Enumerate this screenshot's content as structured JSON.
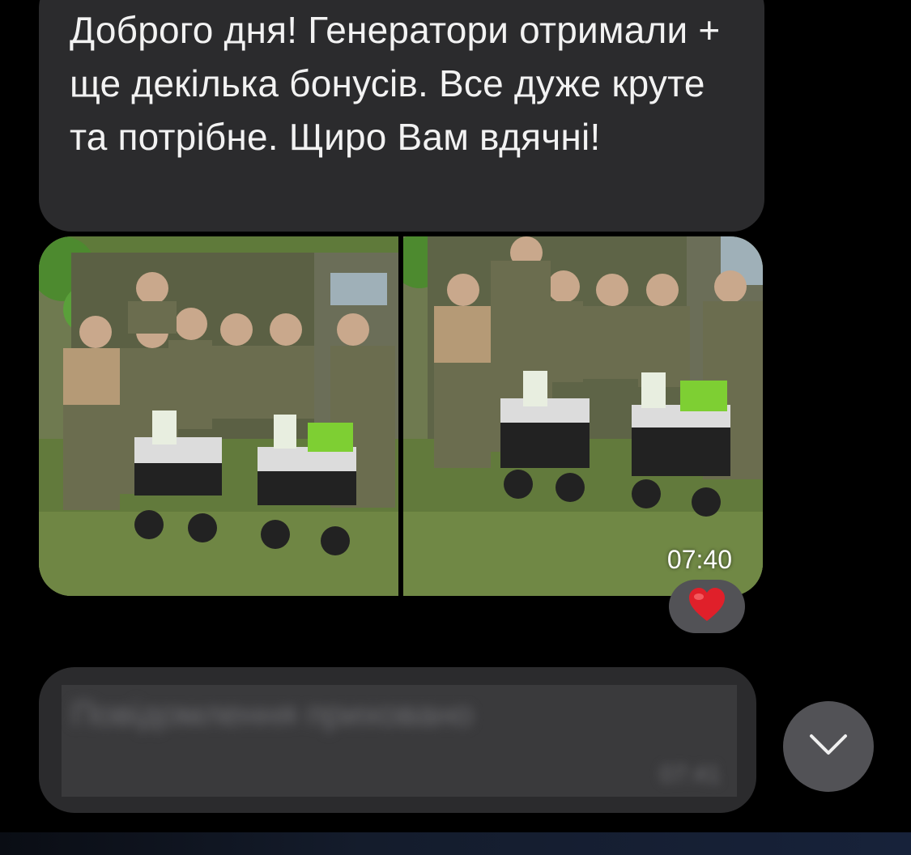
{
  "messages": {
    "incoming_text": "Доброго дня! Генератори отримали + ще декілька бонусів. Все дуже круте та потрібне. Щиро Вам вдячні!",
    "photo_time": "07:40",
    "reaction": "❤️",
    "blurred_text": "Повідомлення приховано",
    "blurred_time": "07:41"
  },
  "icons": {
    "reaction": "heart-icon",
    "scroll": "chevron-down-icon"
  },
  "colors": {
    "background": "#000000",
    "bubble": "#2b2b2d",
    "reaction_bg": "#525256",
    "heart": "#e0202a"
  }
}
